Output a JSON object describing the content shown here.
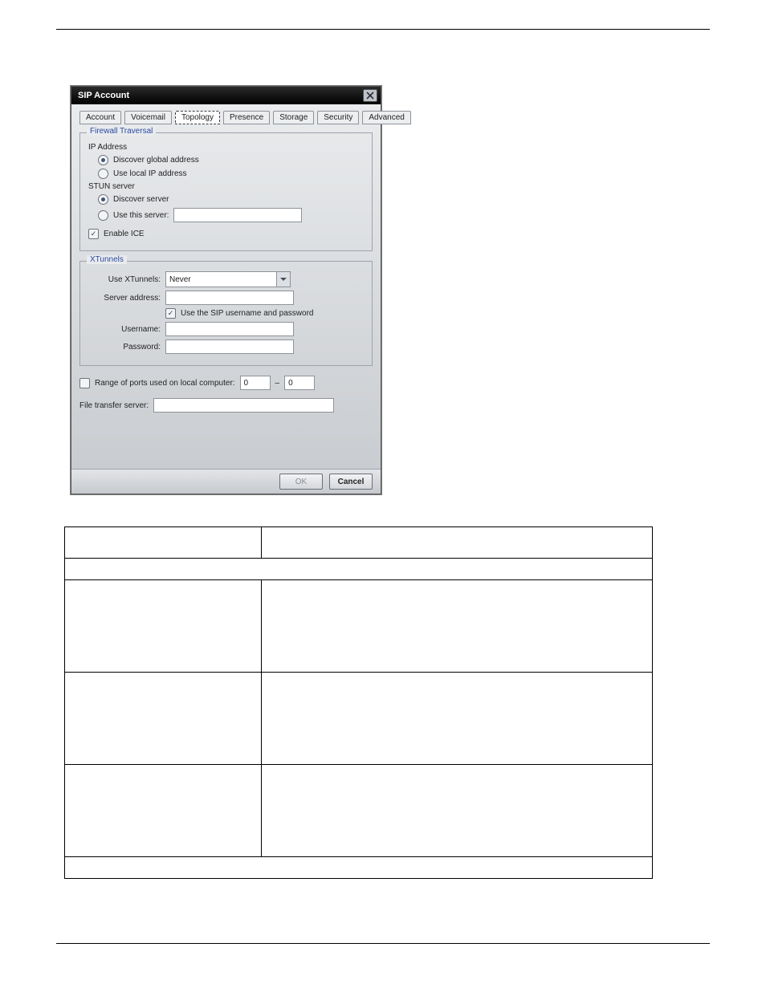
{
  "dialog": {
    "title": "SIP Account",
    "tabs": [
      "Account",
      "Voicemail",
      "Topology",
      "Presence",
      "Storage",
      "Security",
      "Advanced"
    ],
    "active_tab": "Topology",
    "firewall": {
      "legend": "Firewall Traversal",
      "ip_label": "IP Address",
      "ip_opt_global": "Discover global address",
      "ip_opt_local": "Use local IP address",
      "stun_label": "STUN server",
      "stun_opt_discover": "Discover server",
      "stun_opt_use": "Use this server:",
      "stun_server_value": "",
      "enable_ice": "Enable ICE"
    },
    "xtunnels": {
      "legend": "XTunnels",
      "use_label": "Use XTunnels:",
      "use_value": "Never",
      "server_label": "Server address:",
      "server_value": "",
      "sip_creds": "Use the SIP username and password",
      "username_label": "Username:",
      "username_value": "",
      "password_label": "Password:",
      "password_value": ""
    },
    "ports": {
      "label": "Range of ports used on local computer:",
      "from": "0",
      "dash": "–",
      "to": "0"
    },
    "fts": {
      "label": "File transfer server:",
      "value": ""
    },
    "buttons": {
      "ok": "OK",
      "cancel": "Cancel"
    }
  }
}
